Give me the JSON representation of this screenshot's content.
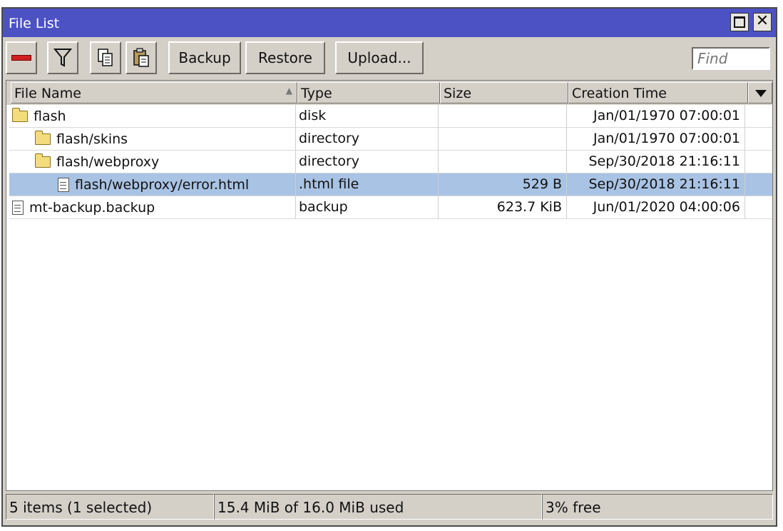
{
  "window": {
    "title": "File List"
  },
  "toolbar": {
    "backup_label": "Backup",
    "restore_label": "Restore",
    "upload_label": "Upload...",
    "find_placeholder": "Find"
  },
  "table": {
    "columns": [
      "File Name",
      "Type",
      "Size",
      "Creation Time"
    ],
    "rows": [
      {
        "name": "flash",
        "type": "disk",
        "size": "",
        "created": "Jan/01/1970 07:00:01",
        "icon": "folder-icon",
        "selected": false
      },
      {
        "name": "flash/skins",
        "type": "directory",
        "size": "",
        "created": "Jan/01/1970 07:00:01",
        "icon": "folder-icon",
        "selected": false
      },
      {
        "name": "flash/webproxy",
        "type": "directory",
        "size": "",
        "created": "Sep/30/2018 21:16:11",
        "icon": "folder-icon",
        "selected": false
      },
      {
        "name": "flash/webproxy/error.html",
        "type": ".html file",
        "size": "529 B",
        "created": "Sep/30/2018 21:16:11",
        "icon": "file-icon",
        "selected": true
      },
      {
        "name": "mt-backup.backup",
        "type": "backup",
        "size": "623.7 KiB",
        "created": "Jun/01/2020 04:00:06",
        "icon": "file-icon",
        "selected": false
      }
    ]
  },
  "status": {
    "items": "5 items (1 selected)",
    "usage": "15.4 MiB of 16.0 MiB used",
    "free": "3% free"
  },
  "colors": {
    "titlebar": "#4c52c4",
    "selected_row": "#a9c3e4",
    "window_bg": "#d4d0c8"
  }
}
